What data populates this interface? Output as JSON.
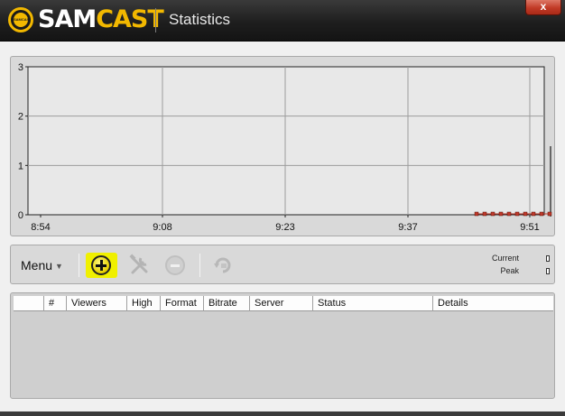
{
  "window": {
    "brand_prefix": "SAM",
    "brand_suffix": "CAST",
    "logo_text": "SAMCAST",
    "title": "Statistics",
    "close_label": "x"
  },
  "colors": {
    "brand_yellow": "#f2b800",
    "highlight_yellow": "#f0f000",
    "series_red": "#c0392b",
    "close_red": "#c13a26"
  },
  "chart_data": {
    "type": "line",
    "x_ticks": [
      "8:54",
      "9:08",
      "9:23",
      "9:37",
      "9:51"
    ],
    "y_ticks": [
      "0",
      "1",
      "2",
      "3"
    ],
    "ylim": [
      0,
      3
    ],
    "grid": true,
    "series": [
      {
        "values": [
          0,
          0,
          0,
          0,
          0,
          0,
          0,
          0,
          0,
          0
        ]
      }
    ]
  },
  "toolbar": {
    "menu_label": "Menu",
    "icons": {
      "add": "add-circle-icon",
      "tools": "tools-icon",
      "remove": "remove-circle-icon",
      "refresh": "refresh-icon"
    },
    "legend": {
      "current_label": "Current",
      "peak_label": "Peak"
    }
  },
  "table": {
    "columns": [
      "",
      "#",
      "Viewers",
      "High",
      "Format",
      "Bitrate",
      "Server",
      "Status",
      "Details"
    ],
    "rows": []
  }
}
